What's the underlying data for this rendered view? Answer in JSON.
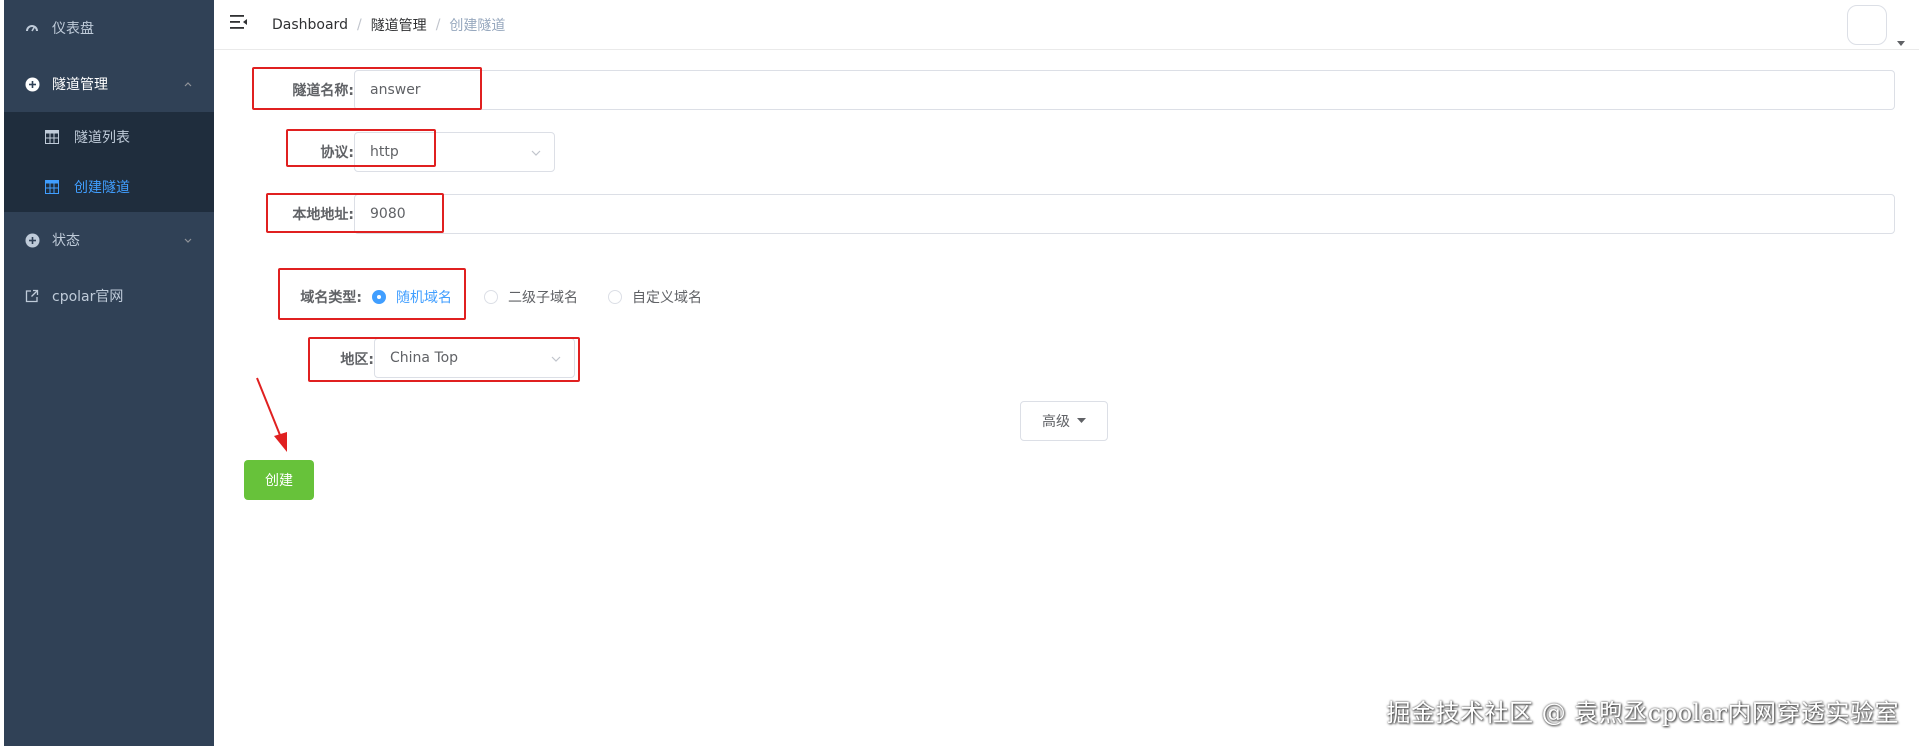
{
  "sidebar": {
    "items": [
      {
        "label": "仪表盘",
        "icon": "dashboard-icon"
      },
      {
        "label": "隧道管理",
        "icon": "plus-circle-icon"
      },
      {
        "label": "状态",
        "icon": "plus-circle-icon"
      },
      {
        "label": "cpolar官网",
        "icon": "external-link-icon"
      }
    ],
    "sub_items": [
      {
        "label": "隧道列表",
        "icon": "table-icon"
      },
      {
        "label": "创建隧道",
        "icon": "table-icon"
      }
    ]
  },
  "header": {
    "breadcrumb": [
      "Dashboard",
      "隧道管理",
      "创建隧道"
    ]
  },
  "form": {
    "tunnel_name_label": "隧道名称:",
    "tunnel_name_value": "answer",
    "protocol_label": "协议:",
    "protocol_value": "http",
    "local_addr_label": "本地地址:",
    "local_addr_value": "9080",
    "domain_type_label": "域名类型:",
    "domain_options": [
      "随机域名",
      "二级子域名",
      "自定义域名"
    ],
    "domain_selected": "随机域名",
    "region_label": "地区:",
    "region_value": "China Top",
    "advanced_label": "高级",
    "create_label": "创建"
  },
  "watermark": "掘金技术社区 @ 袁煦丞cpolar内网穿透实验室",
  "colors": {
    "sidebar_bg": "#304156",
    "submenu_bg": "#1f2d3d",
    "accent": "#409eff",
    "create_button": "#67c23a",
    "highlight": "#e02020"
  }
}
